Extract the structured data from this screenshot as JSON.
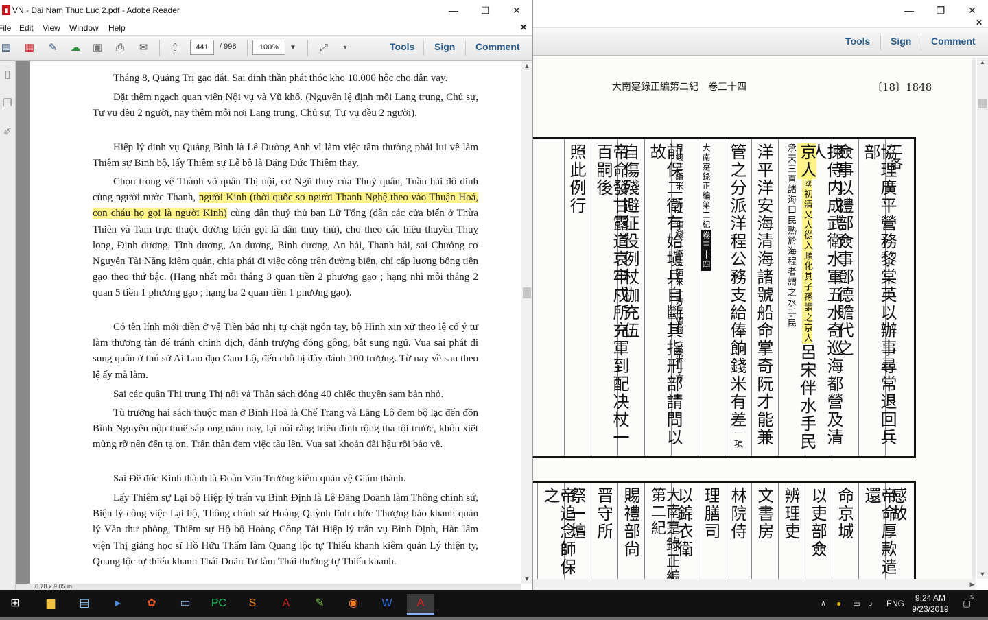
{
  "left_window": {
    "title": "VN - Dai Nam Thuc Luc 2.pdf - Adobe Reader",
    "menu": [
      "File",
      "Edit",
      "View",
      "Window",
      "Help"
    ],
    "page_current": "441",
    "page_total": "/ 998",
    "zoom": "100%",
    "panel_buttons": [
      "Tools",
      "Sign",
      "Comment"
    ],
    "status": "6.78 x 9.05 in",
    "paragraphs": [
      {
        "text": "Tháng 8, Quảng Trị gạo đắt. Sai dinh thần phát thóc kho 10.000 hộc cho dân vay."
      },
      {
        "text": "Đặt thêm ngạch quan viên Nội vụ và Vũ khố. (Nguyên lệ định mỗi Lang trung, Chủ sự, Tư vụ đều 2 người, nay thêm mỗi nơi Lang trung, Chủ sự, Tư vụ đều 2 người)."
      },
      {
        "text": "Hiệp lý dinh vụ Quảng Bình là Lê Đường Anh vì làm việc tầm thường phải lui về làm Thiêm sự Binh bộ, lấy Thiêm sự Lễ bộ là Đặng Đức Thiệm thay."
      },
      {
        "before": "Chọn trong vệ Thành võ quân Thị nội, cơ Ngũ thuỷ của Thuỷ quân, Tuần hải đô dinh cùng người nước Thanh,",
        "highlight": "người Kinh (thời quốc sơ người Thanh Nghệ theo vào Thuận Hoá, con cháu họ gọi là người Kinh)",
        "after": "cùng dân thuỷ thủ ban Lữ Tống (dân các cửa biển ở Thừa Thiên và Tam trực thuộc đường biển gọi là dân thủy thủ), cho theo các hiệu thuyền Thuỵ long, Định dương, Tĩnh dương, An dương, Bình dương, An hải, Thanh hải, sai Chưởng cơ Nguyễn Tài Năng kiêm quản, chia phái đi việc công trên đường biển, chỉ cấp lương bổng tiền gạo theo thứ bậc. (Hạng nhất mỗi tháng 3 quan tiền 2 phương gạo ; hạng nhì mỗi tháng 2 quan 5 tiền 1 phương gạo ; hạng ba 2 quan tiền 1 phương gạo)."
      },
      {
        "text": "Có tên lính mới điền ở vệ Tiền bảo nhị tự chặt ngón tay, bộ Hình xin xử theo lệ cố ý tự làm thương tàn để tránh chinh dịch, đánh trượng đóng gông, bắt sung ngũ. Vua sai phát đi sung quân ở thú sở Ai Lao đạo Cam Lộ, đến chỗ bị đày đánh 100 trượng. Từ nay về sau theo lệ ấy mà làm."
      },
      {
        "text": "Sai các quân Thị trung Thị nội và Thần sách đóng 40 chiếc thuyền sam bản nhỏ."
      },
      {
        "text": "Tù trưởng hai sách thuộc man ở Bình Hoà là Chế Trang và Lăng Lô đem bộ lạc đến đồn Bình Nguyên nộp thuế sáp ong năm nay, lại nói rằng triều đình rộng tha tội trước, khôn xiết mừng rỡ nên đến tạ ơn. Trấn thần đem việc tâu lên. Vua sai khoản đãi hậu rồi bảo về."
      },
      {
        "text": "Sai Đề đốc Kinh thành là Đoàn Văn Trường kiêm quản vệ Giám thành."
      },
      {
        "text": "Lấy Thiêm sự Lại bộ Hiệp lý trấn vụ Bình Định là Lê Đăng Doanh làm Thông chính sứ, Biện lý công việc Lại bộ, Thông chính sứ Hoàng Quỳnh lĩnh chức Thượng bảo khanh quản lý Văn thư phòng, Thiêm sự Hộ bộ Hoàng Công Tài Hiệp lý trấn vụ Bình Định, Hàn lâm viện Thị giảng học sĩ Hồ Hữu Thẩm làm Quang lộc tự Thiếu khanh kiêm quản Lý thiện ty, Quang lộc tự thiếu khanh Thái Doãn Tư làm Thái thường tự Thiếu khanh."
      }
    ]
  },
  "right_window": {
    "panel_buttons": [
      "Tools",
      "Sign",
      "Comment"
    ],
    "running_head": "大南寔錄正編第二紀　卷三十四",
    "page_number": "〔18〕1848",
    "columns": [
      {
        "text": "二各",
        "size": "m"
      },
      {
        "text": "協理廣平營務黎棠英以辦事尋常退回兵部",
        "size": "l"
      },
      {
        "text": "僉事以禮部僉事鄧德贍代之",
        "size": "l"
      },
      {
        "text": "揀侍内成武衛水軍五水奇巡海都營及清人",
        "size": "l"
      },
      {
        "text": "京人",
        "annot": "國初清乂人從入順化其子孫謂之京人",
        "after": "呂宋伴水手民",
        "annot2": "承天三直諸海口民熟於海程者謂之水手民",
        "size": "l"
      },
      {
        "text": "洋平洋安海清海諸號船命掌奇阮才能兼",
        "size": "l"
      },
      {
        "text": "管之分派洋程公務支給俸餉錢米有差",
        "annot": "一項",
        "size": "l"
      },
      {
        "text": "大南寔錄正編第二紀",
        "banner": "卷三十四",
        "size": "s"
      },
      {
        "text": "月錢三緡米二方二項錢二緡五陌米一方三項錢二緡米一方",
        "size": "s"
      },
      {
        "text": "前保二衛有始塡兵自斷其指刑部請問以故",
        "size": "l"
      },
      {
        "text": "自傷殘避征役例杖枷充伍",
        "size": "l"
      },
      {
        "text": "帝命發甘露道哀牢戍所充軍到配决杖一百嗣後",
        "size": "l"
      },
      {
        "text": "照此例行",
        "size": "l"
      }
    ],
    "second_frame": [
      "感故",
      "帝命厚款遣還",
      "命京城",
      "以吏部僉",
      "辨理吏",
      "文書房",
      "林院侍",
      "理膳司",
      "以錦衣衛",
      "大南寔錄正編第二紀",
      "賜禮部尙",
      "晋守所",
      "祭一壇",
      "帝追念師保之"
    ]
  },
  "taskbar": {
    "apps": [
      {
        "name": "windows-start",
        "glyph": "⊞"
      },
      {
        "name": "file-explorer",
        "glyph": "▆"
      },
      {
        "name": "notepad",
        "glyph": "▤"
      },
      {
        "name": "powershell",
        "glyph": "▸"
      },
      {
        "name": "photo-app",
        "glyph": "✿"
      },
      {
        "name": "task-view",
        "glyph": "▭"
      },
      {
        "name": "pycharm",
        "glyph": "PC"
      },
      {
        "name": "sublime",
        "glyph": "S"
      },
      {
        "name": "acrobat",
        "glyph": "A"
      },
      {
        "name": "notepad-plus",
        "glyph": "✎"
      },
      {
        "name": "firefox",
        "glyph": "◉"
      },
      {
        "name": "word",
        "glyph": "W"
      },
      {
        "name": "adobe-reader",
        "glyph": "A"
      }
    ],
    "lang": "ENG",
    "time": "9:24 AM",
    "date": "9/23/2019",
    "notifications": "5"
  },
  "colors": {
    "highlight": "#fff38a",
    "accent": "#2d5d8c",
    "taskbar": "#121212"
  }
}
